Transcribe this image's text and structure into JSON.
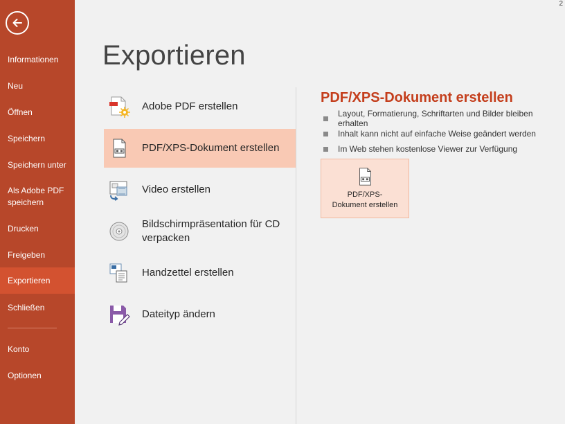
{
  "top_right_text": "2",
  "sidebar": {
    "back_icon": "back-arrow-icon",
    "items": [
      {
        "label": "Informationen"
      },
      {
        "label": "Neu"
      },
      {
        "label": "Öffnen"
      },
      {
        "label": "Speichern"
      },
      {
        "label": "Speichern unter"
      },
      {
        "label": "Als Adobe PDF speichern"
      },
      {
        "label": "Drucken"
      },
      {
        "label": "Freigeben"
      },
      {
        "label": "Exportieren",
        "active": true
      },
      {
        "label": "Schließen"
      },
      {
        "label": "Konto"
      },
      {
        "label": "Optionen"
      }
    ]
  },
  "main": {
    "title": "Exportieren",
    "options": [
      {
        "label": "Adobe PDF erstellen",
        "icon": "adobe-pdf-icon"
      },
      {
        "label": "PDF/XPS-Dokument erstellen",
        "icon": "pdf-xps-document-icon",
        "selected": true
      },
      {
        "label": "Video erstellen",
        "icon": "video-icon"
      },
      {
        "label": "Bildschirmpräsentation für CD verpacken",
        "icon": "cd-icon"
      },
      {
        "label": "Handzettel erstellen",
        "icon": "handout-icon"
      },
      {
        "label": "Dateityp ändern",
        "icon": "save-as-type-icon"
      }
    ]
  },
  "detail": {
    "title": "PDF/XPS-Dokument erstellen",
    "bullets": [
      "Layout, Formatierung, Schriftarten und Bilder bleiben erhalten",
      "Inhalt kann nicht auf einfache Weise geändert werden",
      "Im Web stehen kostenlose Viewer zur Verfügung"
    ],
    "button_label": "PDF/XPS-Dokument erstellen",
    "button_label_line1": "PDF/XPS-",
    "button_label_line2": "Dokument erstellen"
  },
  "colors": {
    "sidebar": "#b7472a",
    "sidebar_active": "#d35230",
    "selected_option": "#f9c9b4",
    "accent_title": "#c43e1c"
  }
}
